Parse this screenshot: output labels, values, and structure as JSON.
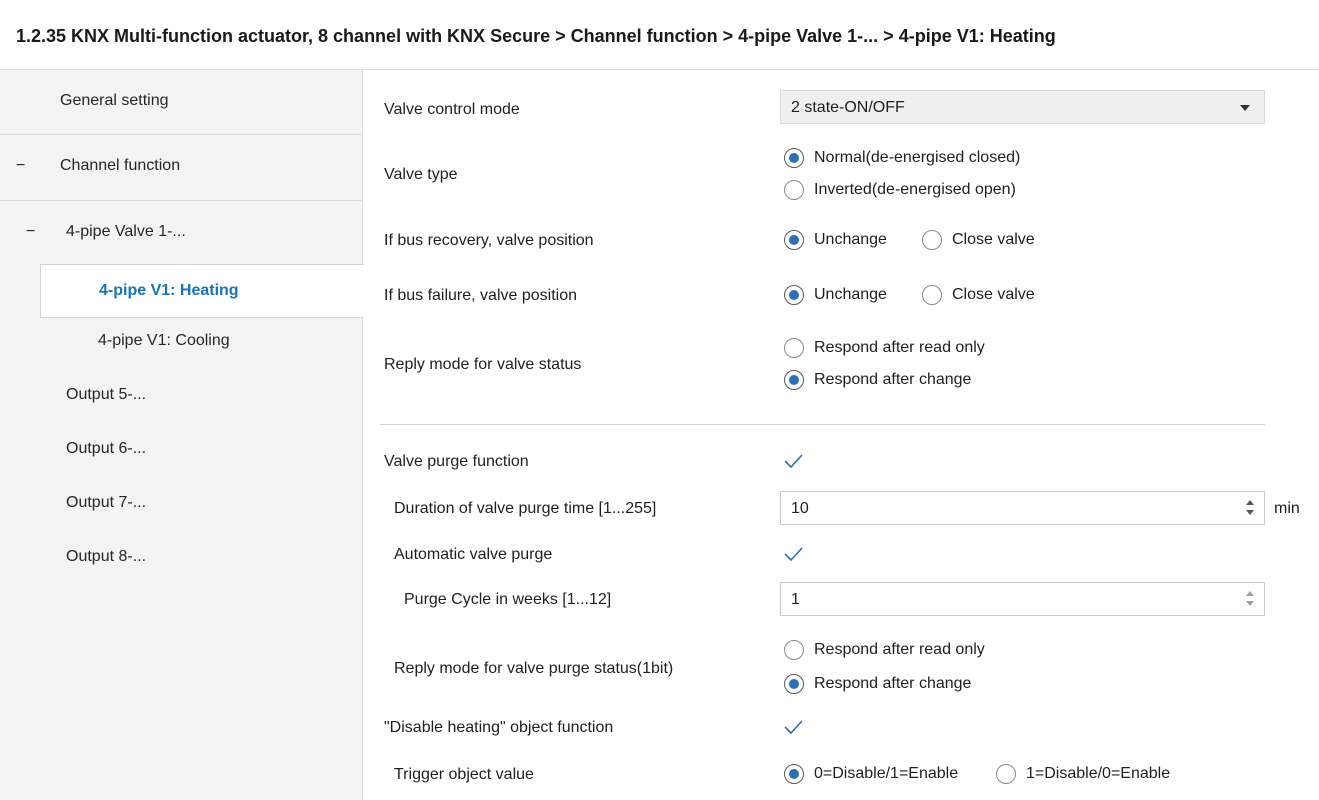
{
  "breadcrumb": "1.2.35 KNX Multi-function actuator, 8 channel with KNX Secure > Channel function > 4-pipe Valve 1-... > 4-pipe V1: Heating",
  "sidebar": {
    "items": [
      {
        "label": "General setting"
      },
      {
        "label": "Channel function",
        "expanded": true
      },
      {
        "label": "4-pipe Valve 1-...",
        "expanded": true
      },
      {
        "label": "4-pipe V1: Heating",
        "selected": true
      },
      {
        "label": "4-pipe V1: Cooling"
      },
      {
        "label": "Output 5-..."
      },
      {
        "label": "Output 6-..."
      },
      {
        "label": "Output 7-..."
      },
      {
        "label": "Output 8-..."
      }
    ],
    "collapse_symbol": "−"
  },
  "params": {
    "valve_control_mode": {
      "label": "Valve control mode",
      "value": "2 state-ON/OFF"
    },
    "valve_type": {
      "label": "Valve type",
      "options": [
        "Normal(de-energised closed)",
        "Inverted(de-energised open)"
      ],
      "selected": 0
    },
    "bus_recovery": {
      "label": "If bus recovery, valve position",
      "options": [
        "Unchange",
        "Close valve"
      ],
      "selected": 0
    },
    "bus_failure": {
      "label": "If bus failure, valve position",
      "options": [
        "Unchange",
        "Close valve"
      ],
      "selected": 0
    },
    "reply_mode_status": {
      "label": "Reply mode for valve status",
      "options": [
        "Respond after read only",
        "Respond after change"
      ],
      "selected": 1
    },
    "valve_purge_function": {
      "label": "Valve purge function",
      "checked": true
    },
    "purge_duration": {
      "label": "Duration of valve purge time [1...255]",
      "value": "10",
      "unit": "min"
    },
    "auto_purge": {
      "label": "Automatic valve purge",
      "checked": true
    },
    "purge_cycle": {
      "label": "Purge Cycle in weeks [1...12]",
      "value": "1"
    },
    "reply_mode_purge": {
      "label": "Reply mode for valve purge status(1bit)",
      "options": [
        "Respond after read only",
        "Respond after change"
      ],
      "selected": 1
    },
    "disable_heating": {
      "label": "\"Disable heating\" object function",
      "checked": true
    },
    "trigger_value": {
      "label": "Trigger object value",
      "options": [
        "0=Disable/1=Enable",
        "1=Disable/0=Enable"
      ],
      "selected": 0
    }
  },
  "colors": {
    "accent": "#1673b9",
    "radio_fill": "#2f6fb5",
    "check": "#2f6fb5"
  }
}
